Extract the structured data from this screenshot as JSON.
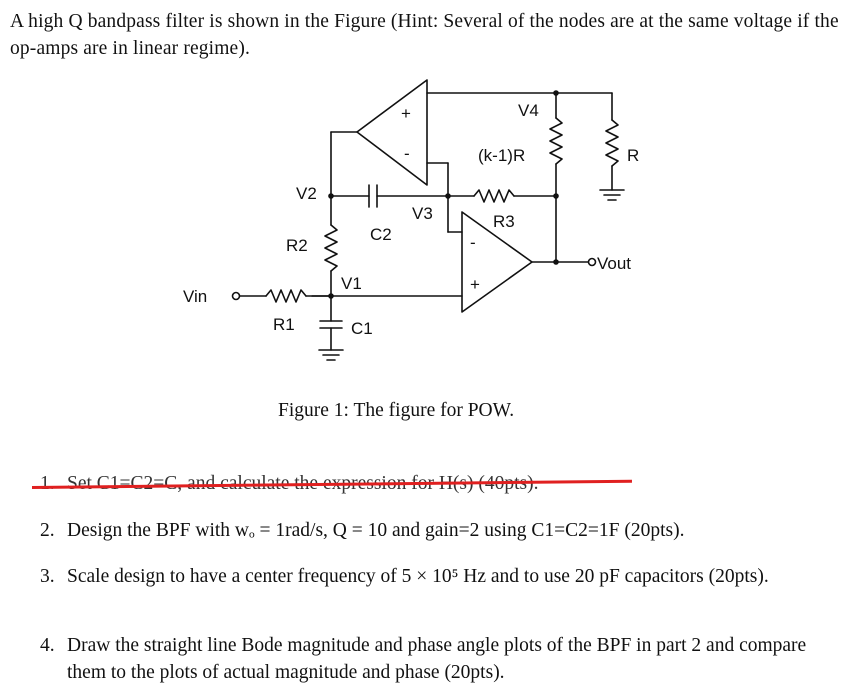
{
  "intro": {
    "text": "A high Q bandpass filter is shown in the Figure (Hint: Several of the nodes are at the same voltage if the op-amps are in linear regime)."
  },
  "figure": {
    "labels": {
      "v4": "V4",
      "k1r": "(k-1)R",
      "r": "R",
      "v2": "V2",
      "v3": "V3",
      "r3": "R3",
      "c2": "C2",
      "r2": "R2",
      "v1": "V1",
      "vout": "Vout",
      "vin": "Vin",
      "r1": "R1",
      "c1": "C1",
      "plus_top": "+",
      "minus_top": "-",
      "plus_bot": "+",
      "minus_bot": "-"
    },
    "caption": "Figure 1: The figure for POW."
  },
  "questions": [
    {
      "number": "1.",
      "text": "Set C1=C2=C, and calculate the expression for H(s) (40pts).",
      "struck": true
    },
    {
      "number": "2.",
      "text": "Design the BPF with wₒ = 1rad/s, Q = 10 and gain=2 using C1=C2=1F (20pts).",
      "struck": false
    },
    {
      "number": "3.",
      "text": "Scale design to have a center frequency of 5 × 10⁵ Hz and to use 20 pF capacitors (20pts).",
      "struck": false
    },
    {
      "number": "4.",
      "text": "Draw the straight line Bode magnitude and phase angle plots of the BPF in part 2 and compare them to the plots of actual magnitude and phase (20pts).",
      "struck": false
    }
  ],
  "annotation": {
    "strike_color": "#e02020"
  }
}
